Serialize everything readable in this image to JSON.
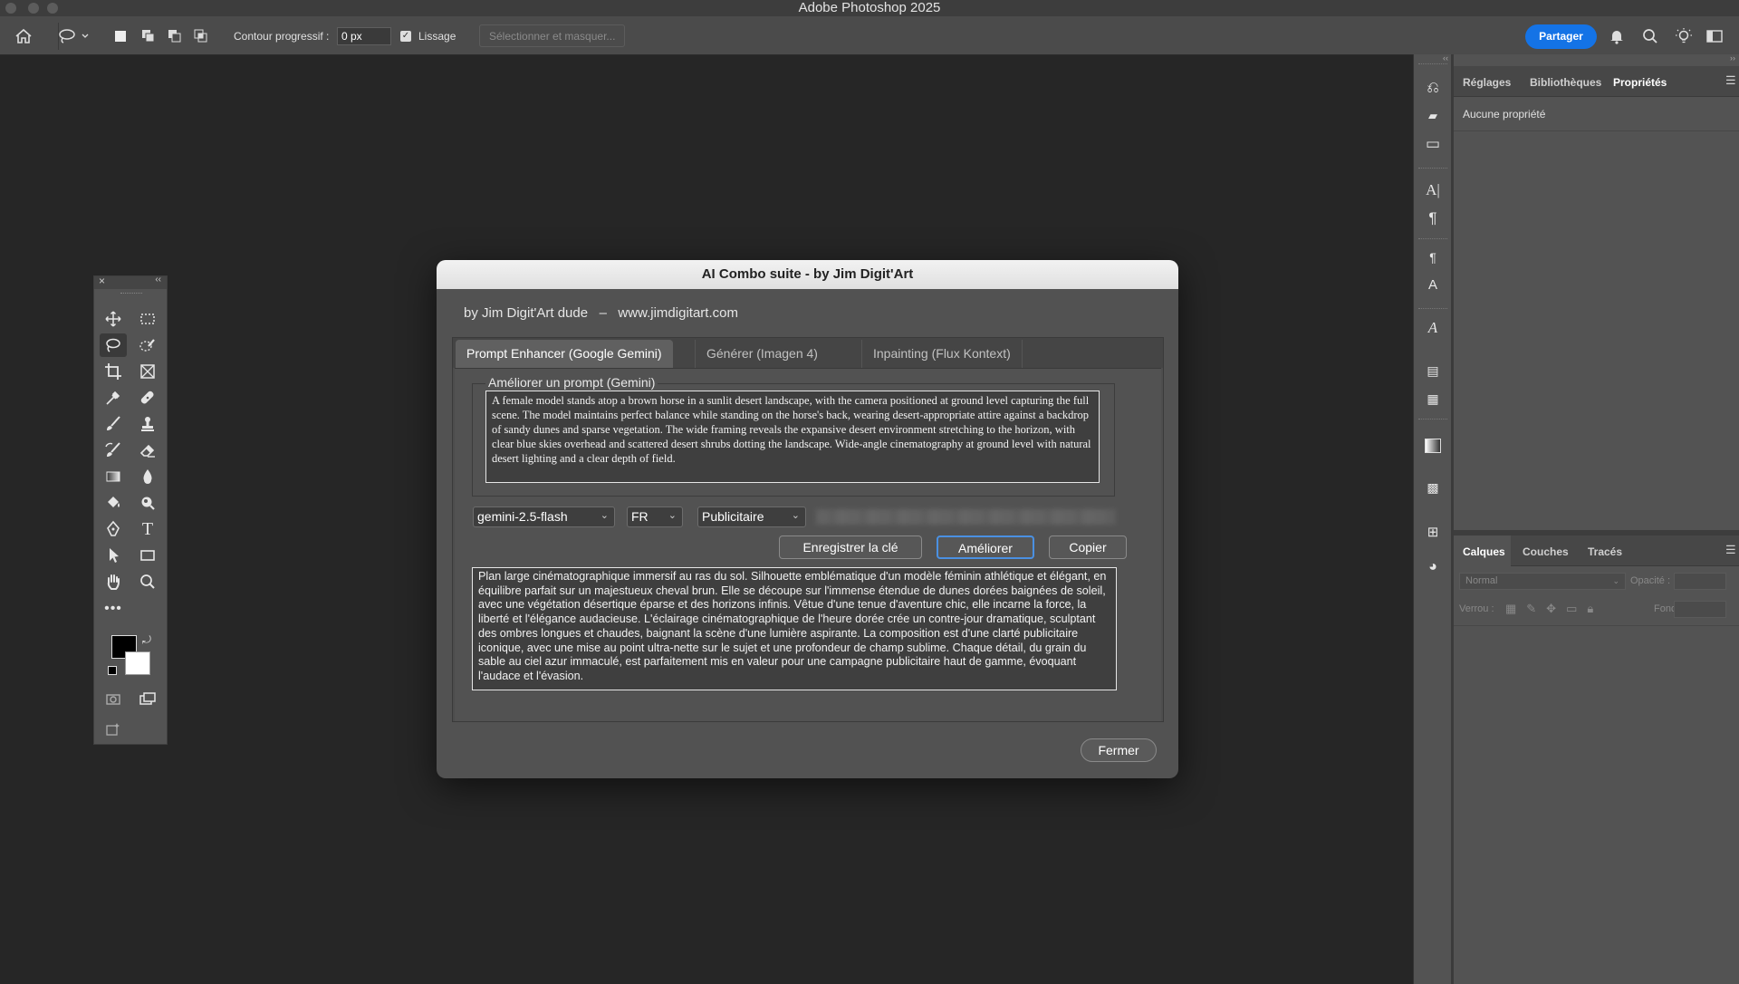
{
  "app": {
    "title": "Adobe Photoshop 2025"
  },
  "options_bar": {
    "feather_label": "Contour progressif :",
    "feather_value": "0 px",
    "smoothing_label": "Lissage",
    "select_mask_label": "Sélectionner et masquer...",
    "share_label": "Partager"
  },
  "properties_panel": {
    "tabs": [
      "Réglages",
      "Bibliothèques",
      "Propriétés"
    ],
    "empty_text": "Aucune propriété"
  },
  "layers_panel": {
    "tabs": [
      "Calques",
      "Couches",
      "Tracés"
    ],
    "blend_mode": "Normal",
    "opacity_label": "Opacité :",
    "lock_label": "Verrou :",
    "fill_label": "Fond :"
  },
  "dialog": {
    "title": "AI Combo suite - by Jim Digit'Art",
    "byline": "by Jim Digit'Art dude   –   www.jimdigitart.com",
    "tabs": [
      "Prompt Enhancer (Google Gemini)",
      "Générer (Imagen 4)",
      "Inpainting (Flux Kontext)"
    ],
    "group_label": "Améliorer un prompt (Gemini)",
    "prompt_text": "A female model stands atop a brown horse in a sunlit desert landscape, with the camera positioned at ground level capturing the full scene. The model maintains perfect balance while standing on the horse's back, wearing desert-appropriate attire against a backdrop of sandy dunes and sparse vegetation. The wide framing reveals the expansive desert environment stretching to the horizon, with clear blue skies overhead and scattered desert shrubs dotting the landscape. Wide-angle cinematography at ground level with natural desert lighting and a clear depth of field.",
    "model": "gemini-2.5-flash",
    "language": "FR",
    "style": "Publicitaire",
    "save_key_label": "Enregistrer la clé",
    "improve_label": "Améliorer",
    "copy_label": "Copier",
    "result_text": "Plan large cinématographique immersif au ras du sol. Silhouette emblématique d'un modèle féminin athlétique et élégant, en équilibre parfait sur un majestueux cheval brun. Elle se découpe sur l'immense étendue de dunes dorées baignées de soleil, avec une végétation désertique éparse et des horizons infinis. Vêtue d'une tenue d'aventure chic, elle incarne la force, la liberté et l'élégance audacieuse. L'éclairage cinématographique de l'heure dorée crée un contre-jour dramatique, sculptant des ombres longues et chaudes, baignant la scène d'une lumière aspirante. La composition est d'une clarté publicitaire iconique, avec une mise au point ultra-nette sur le sujet et une profondeur de champ sublime. Chaque détail, du grain du sable au ciel azur immaculé, est parfaitement mis en valeur pour une campagne publicitaire haut de gamme, évoquant l'audace et l'évasion.",
    "close_label": "Fermer"
  },
  "colors": {
    "accent": "#1473e6",
    "canvas": "#262626",
    "panel": "#535353"
  }
}
